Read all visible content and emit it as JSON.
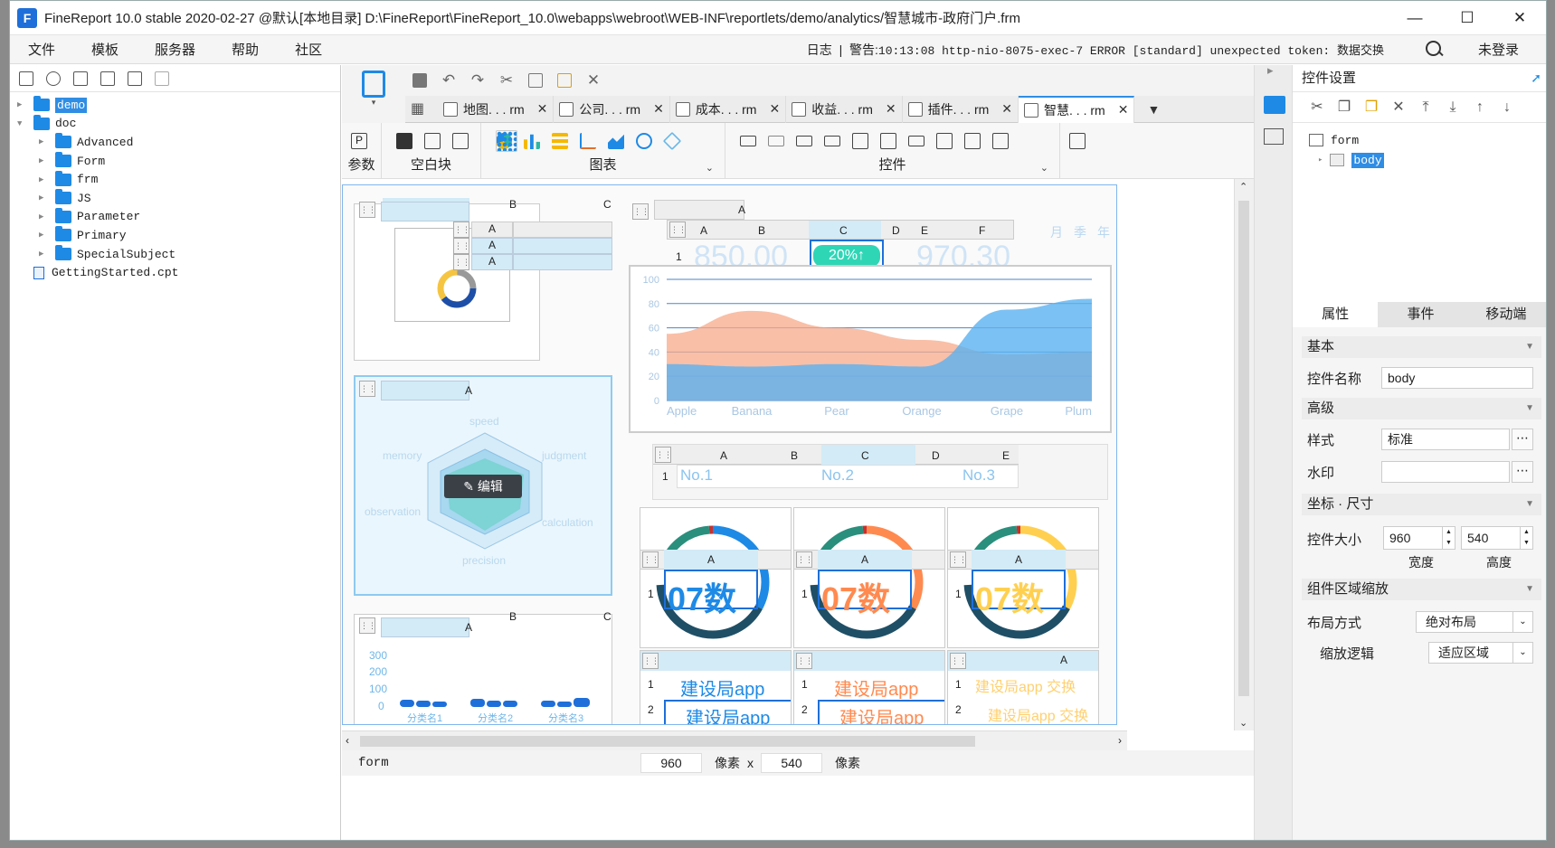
{
  "window": {
    "title": "FineReport 10.0 stable 2020-02-27 @默认[本地目录]    D:\\FineReport\\FineReport_10.0\\webapps\\webroot\\WEB-INF\\reportlets/demo/analytics/智慧城市-政府门户.frm",
    "app_letter": "F"
  },
  "menu": {
    "items": [
      "文件",
      "模板",
      "服务器",
      "帮助",
      "社区"
    ],
    "log_label": "日志",
    "log_message_prefix": "警告:",
    "log_message": "10:13:08 http-nio-8075-exec-7 ERROR [standard] unexpected token: 数据交换",
    "login": "未登录"
  },
  "tree": {
    "nodes": [
      {
        "label": "demo",
        "level": 0,
        "expanded": false,
        "selected": true,
        "type": "folder"
      },
      {
        "label": "doc",
        "level": 0,
        "expanded": true,
        "selected": false,
        "type": "folder"
      },
      {
        "label": "Advanced",
        "level": 1,
        "expanded": false,
        "type": "folder"
      },
      {
        "label": "Form",
        "level": 1,
        "expanded": false,
        "type": "folder"
      },
      {
        "label": "frm",
        "level": 1,
        "expanded": false,
        "type": "folder"
      },
      {
        "label": "JS",
        "level": 1,
        "expanded": false,
        "type": "folder"
      },
      {
        "label": "Parameter",
        "level": 1,
        "expanded": false,
        "type": "folder"
      },
      {
        "label": "Primary",
        "level": 1,
        "expanded": false,
        "type": "folder"
      },
      {
        "label": "SpecialSubject",
        "level": 1,
        "expanded": false,
        "type": "folder"
      },
      {
        "label": "GettingStarted.cpt",
        "level": 0,
        "type": "file"
      }
    ]
  },
  "tabs": [
    {
      "label": "地图. . . rm",
      "active": false
    },
    {
      "label": "公司. . . rm",
      "active": false
    },
    {
      "label": "成本. . . rm",
      "active": false
    },
    {
      "label": "收益. . . rm",
      "active": false
    },
    {
      "label": "插件. . . rm",
      "active": false
    },
    {
      "label": "智慧. . . rm",
      "active": true
    }
  ],
  "ribbon": {
    "param": "参数",
    "blank": "空白块",
    "chart": "图表",
    "control": "控件",
    "param_icon": "P"
  },
  "canvas": {
    "top_headers": [
      "A",
      "B",
      "C",
      "A",
      "B",
      "C",
      "D",
      "E",
      "F"
    ],
    "kpi_big": "850.00",
    "kpi_pct": "20%↑",
    "kpi_big2": "970.30",
    "period_labels": [
      "月",
      "季",
      "年"
    ],
    "area_chart": {
      "type": "area",
      "categories": [
        "Apple",
        "Banana",
        "Pear",
        "Orange",
        "Grape",
        "Plum"
      ],
      "y_ticks": [
        "0",
        "20",
        "40",
        "60",
        "80",
        "100"
      ],
      "ylim": [
        0,
        100
      ],
      "series": [
        {
          "values": [
            55,
            74,
            60,
            50,
            38,
            40
          ],
          "color": "#f7a98a"
        },
        {
          "values": [
            30,
            28,
            30,
            28,
            75,
            84
          ],
          "color": "#5bb1f0"
        }
      ]
    },
    "radar": {
      "labels": [
        "speed",
        "judgment",
        "calculation",
        "precision",
        "observation",
        "memory"
      ],
      "edit_label": "编辑"
    },
    "ranking": {
      "headers": [
        "A",
        "B",
        "C",
        "D",
        "E"
      ],
      "items": [
        "No.1",
        "No.2",
        "No.3"
      ]
    },
    "gauges": {
      "text": "07数",
      "header": "A",
      "row": "1",
      "colors": [
        "#1e8ae6",
        "#ff8a50",
        "#ffd050"
      ]
    },
    "link_rows": {
      "text": "建设局app",
      "text_alt": "建设局app 交换",
      "rows": [
        "1",
        "2"
      ]
    },
    "bar_chart": {
      "type": "bar",
      "categories": [
        "分类名1",
        "分类名2",
        "分类名3"
      ],
      "y_ticks": [
        "0",
        "100",
        "200",
        "300"
      ],
      "ylim": [
        0,
        300
      ]
    },
    "left_headers": [
      "A",
      "A",
      "A"
    ]
  },
  "status": {
    "form": "form",
    "width": "960",
    "unit1": "像素",
    "times": "x",
    "height": "540",
    "unit2": "像素"
  },
  "panel": {
    "title": "控件设置",
    "tree": [
      {
        "label": "form"
      },
      {
        "label": "body",
        "selected": true
      }
    ],
    "tabs": [
      "属性",
      "事件",
      "移动端"
    ],
    "sec_basic": "基本",
    "name_label": "控件名称",
    "name_value": "body",
    "sec_adv": "高级",
    "style_label": "样式",
    "style_value": "标准",
    "watermark_label": "水印",
    "watermark_value": "",
    "sec_size": "坐标 · 尺寸",
    "size_label": "控件大小",
    "width": "960",
    "height": "540",
    "width_label": "宽度",
    "height_label": "高度",
    "sec_zoom": "组件区域缩放",
    "layout_label": "布局方式",
    "layout_value": "绝对布局",
    "zoom_label": "缩放逻辑",
    "zoom_value": "适应区域"
  }
}
